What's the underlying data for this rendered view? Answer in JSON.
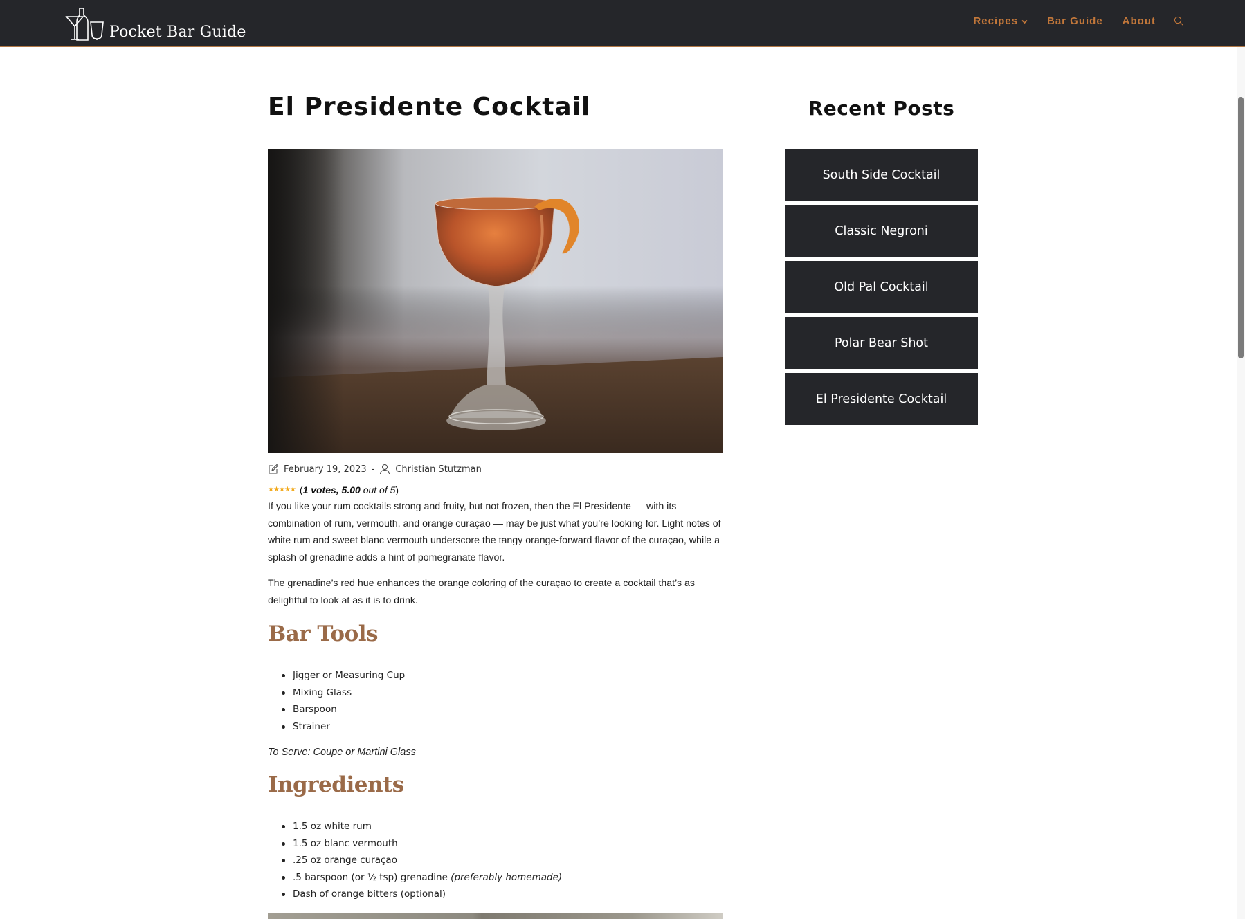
{
  "header": {
    "brand": "Pocket Bar Guide",
    "nav": [
      {
        "label": "Recipes"
      },
      {
        "label": "Bar Guide"
      },
      {
        "label": "About"
      }
    ]
  },
  "article": {
    "title": "El Presidente Cocktail",
    "date": "February 19, 2023",
    "meta_separator": "-",
    "author": "Christian Stutzman",
    "rating": {
      "open_paren": "(",
      "votes": "1 votes,",
      "score": "5.00",
      "out_of": "out of 5",
      "close_paren": ")",
      "stars": 5
    },
    "paragraph1": "If you like your rum cocktails strong and fruity, but not frozen, then the El Presidente — with its combination of rum, vermouth, and orange curaçao — may be just what you’re looking for. Light notes of white rum and sweet blanc vermouth underscore the tangy orange-forward flavor of the curaçao, while a splash of grenadine adds a hint of pomegranate flavor.",
    "paragraph2": "The grenadine’s red hue enhances the orange coloring of the curaçao to create a cocktail that’s as delightful to look at as it is to drink.",
    "bar_tools_heading": "Bar Tools",
    "bar_tools": [
      "Jigger or Measuring Cup",
      "Mixing Glass",
      "Barspoon",
      "Strainer"
    ],
    "serve": "To Serve: Coupe or Martini Glass",
    "ingredients_heading": "Ingredients",
    "ingredients": [
      "1.5 oz white rum",
      "1.5 oz blanc vermouth",
      ".25 oz orange curaçao",
      ".5 barspoon (or ½ tsp) grenadine",
      "Dash of orange bitters (optional)"
    ],
    "ingredient_note": "(preferably homemade)"
  },
  "sidebar": {
    "title": "Recent Posts",
    "posts": [
      {
        "label": "South Side Cocktail"
      },
      {
        "label": "Classic Negroni"
      },
      {
        "label": "Old Pal Cocktail"
      },
      {
        "label": "Polar Bear Shot"
      },
      {
        "label": "El Presidente Cocktail"
      }
    ]
  },
  "colors": {
    "header_bg": "#25262a",
    "nav_accent": "#c2773a",
    "heading_accent": "#9a6a48",
    "star": "#f2a818"
  },
  "icons": {
    "logo": "cocktail-glass-bottle-logo-icon",
    "search": "search-icon",
    "date": "edit-icon",
    "author": "user-icon",
    "chevron": "chevron-down-icon"
  }
}
